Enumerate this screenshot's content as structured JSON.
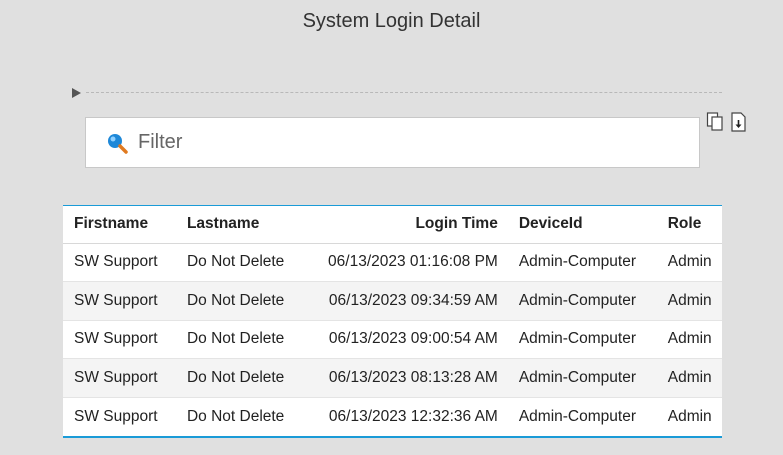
{
  "page": {
    "title": "System Login Detail"
  },
  "filter": {
    "placeholder": "Filter",
    "value": ""
  },
  "toolbar": {
    "icons": [
      "copy-icon",
      "download-icon"
    ]
  },
  "table": {
    "headers": {
      "firstname": "Firstname",
      "lastname": "Lastname",
      "login_time": "Login Time",
      "device_id": "DeviceId",
      "role": "Role"
    },
    "rows": [
      {
        "firstname": "SW Support",
        "lastname": "Do Not Delete",
        "login_time": "06/13/2023 01:16:08 PM",
        "device_id": "Admin-Computer",
        "role": "Admin"
      },
      {
        "firstname": "SW Support",
        "lastname": "Do Not Delete",
        "login_time": "06/13/2023 09:34:59 AM",
        "device_id": "Admin-Computer",
        "role": "Admin"
      },
      {
        "firstname": "SW Support",
        "lastname": "Do Not Delete",
        "login_time": "06/13/2023 09:00:54 AM",
        "device_id": "Admin-Computer",
        "role": "Admin"
      },
      {
        "firstname": "SW Support",
        "lastname": "Do Not Delete",
        "login_time": "06/13/2023 08:13:28 AM",
        "device_id": "Admin-Computer",
        "role": "Admin"
      },
      {
        "firstname": "SW Support",
        "lastname": "Do Not Delete",
        "login_time": "06/13/2023 12:32:36 AM",
        "device_id": "Admin-Computer",
        "role": "Admin"
      }
    ]
  },
  "colors": {
    "accent": "#1a9bd7",
    "search_icon": "#1e88d8",
    "background": "#e0e0e0"
  }
}
